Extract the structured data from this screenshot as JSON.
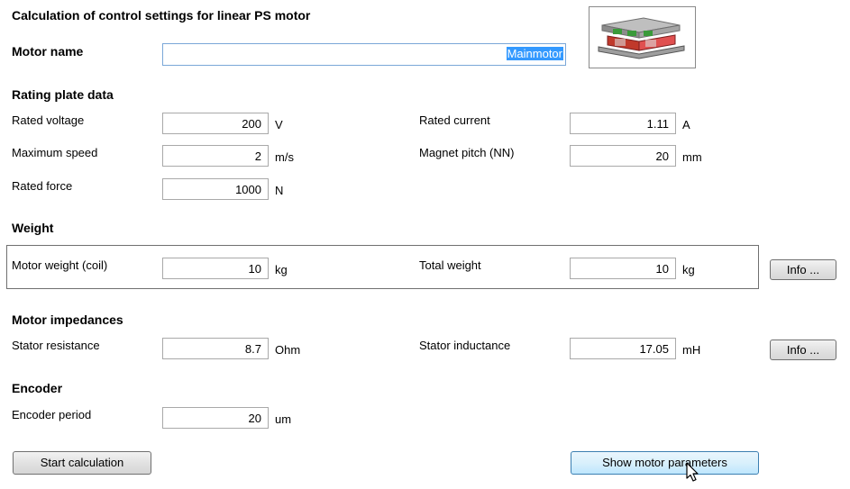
{
  "page": {
    "title": "Calculation of control settings for linear PS motor"
  },
  "motor_name": {
    "label": "Motor name",
    "value": "Mainmotor"
  },
  "motor_image": {
    "icon": "linear-motor-icon"
  },
  "rating": {
    "heading": "Rating plate data",
    "rated_voltage": {
      "label": "Rated voltage",
      "value": "200",
      "unit": "V"
    },
    "rated_current": {
      "label": "Rated current",
      "value": "1.11",
      "unit": "A"
    },
    "max_speed": {
      "label": "Maximum speed",
      "value": "2",
      "unit": "m/s"
    },
    "magnet_pitch": {
      "label": "Magnet pitch (NN)",
      "value": "20",
      "unit": "mm"
    },
    "rated_force": {
      "label": "Rated force",
      "value": "1000",
      "unit": "N"
    }
  },
  "weight": {
    "heading": "Weight",
    "motor_weight": {
      "label": "Motor weight (coil)",
      "value": "10",
      "unit": "kg"
    },
    "total_weight": {
      "label": "Total weight",
      "value": "10",
      "unit": "kg"
    },
    "info_label": "Info ..."
  },
  "impedances": {
    "heading": "Motor impedances",
    "stator_resistance": {
      "label": "Stator resistance",
      "value": "8.7",
      "unit": "Ohm"
    },
    "stator_inductance": {
      "label": "Stator inductance",
      "value": "17.05",
      "unit": "mH"
    },
    "info_label": "Info ..."
  },
  "encoder": {
    "heading": "Encoder",
    "period": {
      "label": "Encoder period",
      "value": "20",
      "unit": "um"
    }
  },
  "buttons": {
    "start_calculation": "Start calculation",
    "show_motor_parameters": "Show motor parameters"
  }
}
